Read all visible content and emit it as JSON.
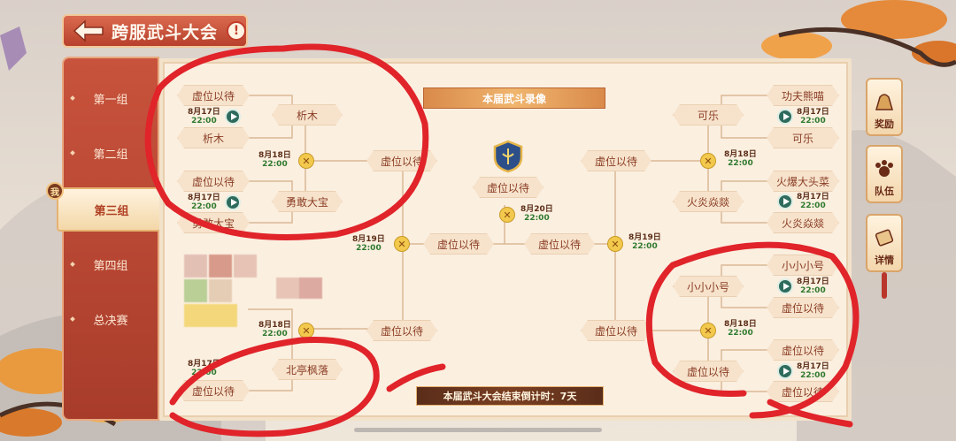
{
  "header": {
    "title": "跨服武斗大会",
    "alert": "!"
  },
  "sidebar": {
    "tabs": [
      {
        "label": "第一组"
      },
      {
        "label": "第二组"
      },
      {
        "label": "第三组",
        "active": true
      },
      {
        "label": "第四组"
      },
      {
        "label": "总决赛"
      }
    ],
    "me_badge": "我"
  },
  "bracket": {
    "banner": "本届武斗录像",
    "countdown": "本届武斗大会结束倒计时：7天",
    "left": {
      "r1": [
        "虚位以待",
        "析木",
        "虚位以待",
        "勇敢大宝",
        "",
        "",
        "北亭枫落",
        "虚位以待"
      ],
      "r2": [
        "析木",
        "勇敢大宝",
        "北亭枫落"
      ],
      "r3": [
        "虚位以待",
        "虚位以待"
      ],
      "r4": "虚位以待"
    },
    "right": {
      "r1": [
        "功夫熊喵",
        "可乐",
        "火爆大头菜",
        "火炎焱燚",
        "小小小号",
        "虚位以待",
        "虚位以待",
        "虚位以待"
      ],
      "r2": [
        "可乐",
        "火炎焱燚",
        "小小小号",
        "虚位以待"
      ],
      "r3": [
        "虚位以待",
        "虚位以待"
      ],
      "r4": "虚位以待"
    },
    "final": "虚位以待",
    "dates": {
      "d17": "8月17日",
      "d18": "8月18日",
      "d19": "8月19日",
      "d20": "8月20日",
      "time": "22:00"
    }
  },
  "right_menu": [
    {
      "label": "奖励",
      "icon": "reward-bag-icon"
    },
    {
      "label": "队伍",
      "icon": "team-paw-icon"
    },
    {
      "label": "详情",
      "icon": "details-scroll-icon"
    }
  ],
  "colors": {
    "accent": "#c8533c",
    "ink": "#e0242a",
    "slot": "#f7e3cc",
    "text": "#8b3d25"
  }
}
